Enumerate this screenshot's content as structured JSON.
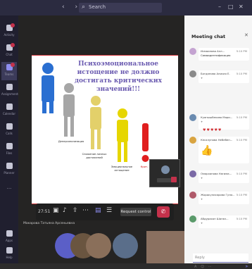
{
  "topbar": {
    "nav_arrows": "‹ ›",
    "search_placeholder": "Search",
    "window_controls": [
      "–",
      "□",
      "✕"
    ]
  },
  "rail": {
    "items": [
      {
        "label": "Activity",
        "badge": true,
        "active": false
      },
      {
        "label": "Chat",
        "badge": true,
        "active": false
      },
      {
        "label": "Teams",
        "badge": true,
        "active": true
      },
      {
        "label": "Assignments",
        "badge": false,
        "active": false
      },
      {
        "label": "Calendar",
        "badge": false,
        "active": false
      },
      {
        "label": "Calls",
        "badge": false,
        "active": false
      },
      {
        "label": "Files",
        "badge": false,
        "active": false
      },
      {
        "label": "Planner",
        "badge": false,
        "active": false
      },
      {
        "label": "...",
        "badge": false,
        "active": false
      },
      {
        "label": "Apps",
        "badge": false,
        "active": false
      },
      {
        "label": "Help",
        "badge": false,
        "active": false
      }
    ]
  },
  "slide": {
    "title": "Психоэмоциональное истощение не должно достигать критических значений!!!",
    "labels": [
      "Деперсонализация",
      "Снижение личных достижений",
      "Эмоциональное истощение"
    ],
    "exclamation": "!",
    "critical_label": "Крит."
  },
  "controls": {
    "timer": "27:51",
    "request_label": "Request control",
    "hangup_icon": "phone-down"
  },
  "caption": "Макарова Татьяна Арсеньевна",
  "chat": {
    "title": "Meeting chat",
    "messages": [
      {
        "name": "Исмаилова Алл...",
        "time": "5:10 PM",
        "body": "Самоидентификация",
        "color": "#c4a3d1"
      },
      {
        "name": "Богданова Алисия Е.",
        "time": "5:10 PM",
        "body": "+",
        "color": "#8a8a8a"
      },
      {
        "name": "Куанышбекова Мари...",
        "time": "5:10 PM",
        "body": "+",
        "color": "#6a8bb0"
      },
      {
        "name": "Кесалунова Небебен...",
        "time": "5:10 PM",
        "body": "👍",
        "color": "#d9a441"
      },
      {
        "name": "Оморханова Нагима...",
        "time": "5:10 PM",
        "body": "+",
        "color": "#7b6aa6"
      },
      {
        "name": "Жоракулисарова Гули...",
        "time": "5:10 PM",
        "body": "+",
        "color": "#b05a6a"
      },
      {
        "name": "Абдурахон Шаназ...",
        "time": "5:10 PM",
        "body": "+",
        "color": "#5a9a6a"
      }
    ],
    "emoji_row": "♥♥♥♥♥",
    "reply_placeholder": "Reply",
    "compose_tools": "A ☺ ⋯",
    "send_icon": "➤"
  },
  "colors": {
    "accent": "#6264a7",
    "alert": "#c4314b",
    "slide_title": "#6a5ab0"
  }
}
